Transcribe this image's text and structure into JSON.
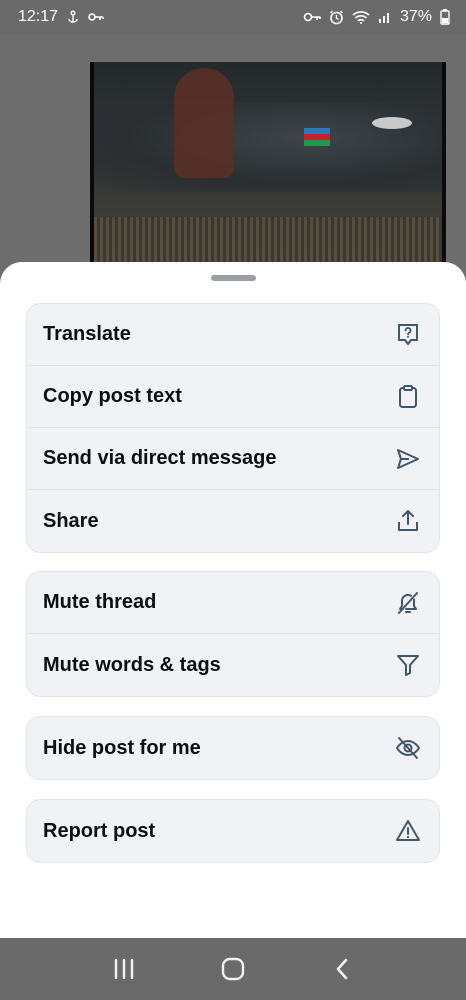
{
  "status_bar": {
    "time": "12:17",
    "battery": "37%",
    "left_icons": [
      "anchor-icon",
      "key-icon"
    ],
    "right_icons": [
      "vpn-key-icon",
      "alarm-icon",
      "wifi-icon",
      "signal-icon",
      "battery-icon"
    ]
  },
  "menu": {
    "groups": [
      {
        "items": [
          {
            "label": "Translate",
            "icon": "translate-bubble-icon"
          },
          {
            "label": "Copy post text",
            "icon": "clipboard-icon"
          },
          {
            "label": "Send via direct message",
            "icon": "send-icon"
          },
          {
            "label": "Share",
            "icon": "share-icon"
          }
        ]
      },
      {
        "items": [
          {
            "label": "Mute thread",
            "icon": "bell-off-icon"
          },
          {
            "label": "Mute words & tags",
            "icon": "filter-icon"
          }
        ]
      },
      {
        "items": [
          {
            "label": "Hide post for me",
            "icon": "eye-off-icon"
          }
        ]
      },
      {
        "items": [
          {
            "label": "Report post",
            "icon": "warning-icon"
          }
        ]
      }
    ]
  },
  "colors": {
    "sheet_bg": "#ffffff",
    "group_bg": "#f0f2f5",
    "text": "#0b0f14",
    "icon": "#42576c",
    "scrim": "#6d6d6d"
  },
  "nav_bar": {
    "buttons": [
      "recent-apps-icon",
      "home-icon",
      "back-icon"
    ]
  }
}
